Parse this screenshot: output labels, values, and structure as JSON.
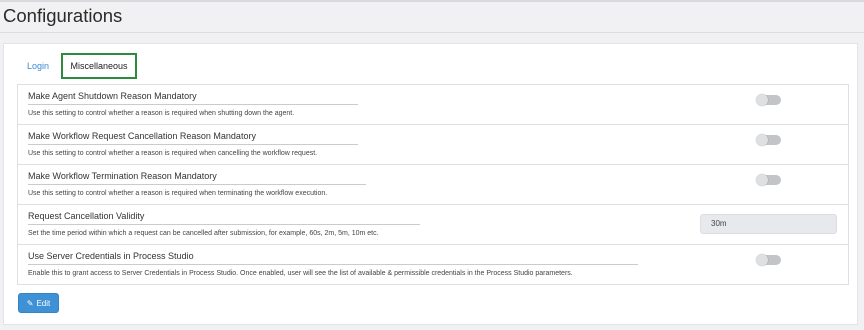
{
  "page": {
    "title": "Configurations"
  },
  "tabs": [
    {
      "label": "Login",
      "active": false
    },
    {
      "label": "Miscellaneous",
      "active": true
    }
  ],
  "settings": [
    {
      "title": "Make Agent Shutdown Reason Mandatory",
      "description": "Use this setting to control whether a reason is required when shutting down the agent.",
      "control": "toggle",
      "enabled": false
    },
    {
      "title": "Make Workflow Request Cancellation Reason Mandatory",
      "description": "Use this setting to control whether a reason is required when cancelling the workflow request.",
      "control": "toggle",
      "enabled": false
    },
    {
      "title": "Make Workflow Termination Reason Mandatory",
      "description": "Use this setting to control whether a reason is required when terminating the workflow execution.",
      "control": "toggle",
      "enabled": false
    },
    {
      "title": "Request Cancellation Validity",
      "description": "Set the time period within which a request can be cancelled after submission, for example, 60s, 2m, 5m, 10m etc.",
      "control": "text",
      "value": "30m"
    },
    {
      "title": "Use Server Credentials in Process Studio",
      "description": "Enable this to grant access to Server Credentials in Process Studio. Once enabled, user will see the list of available & permissible credentials in the Process Studio parameters.",
      "control": "toggle",
      "enabled": false
    }
  ],
  "actions": {
    "edit_label": "Edit",
    "edit_icon": "pencil-icon"
  },
  "colors": {
    "accent": "#3d91d4",
    "active_tab_border": "#2e8a3e",
    "link": "#3b8bd0"
  }
}
